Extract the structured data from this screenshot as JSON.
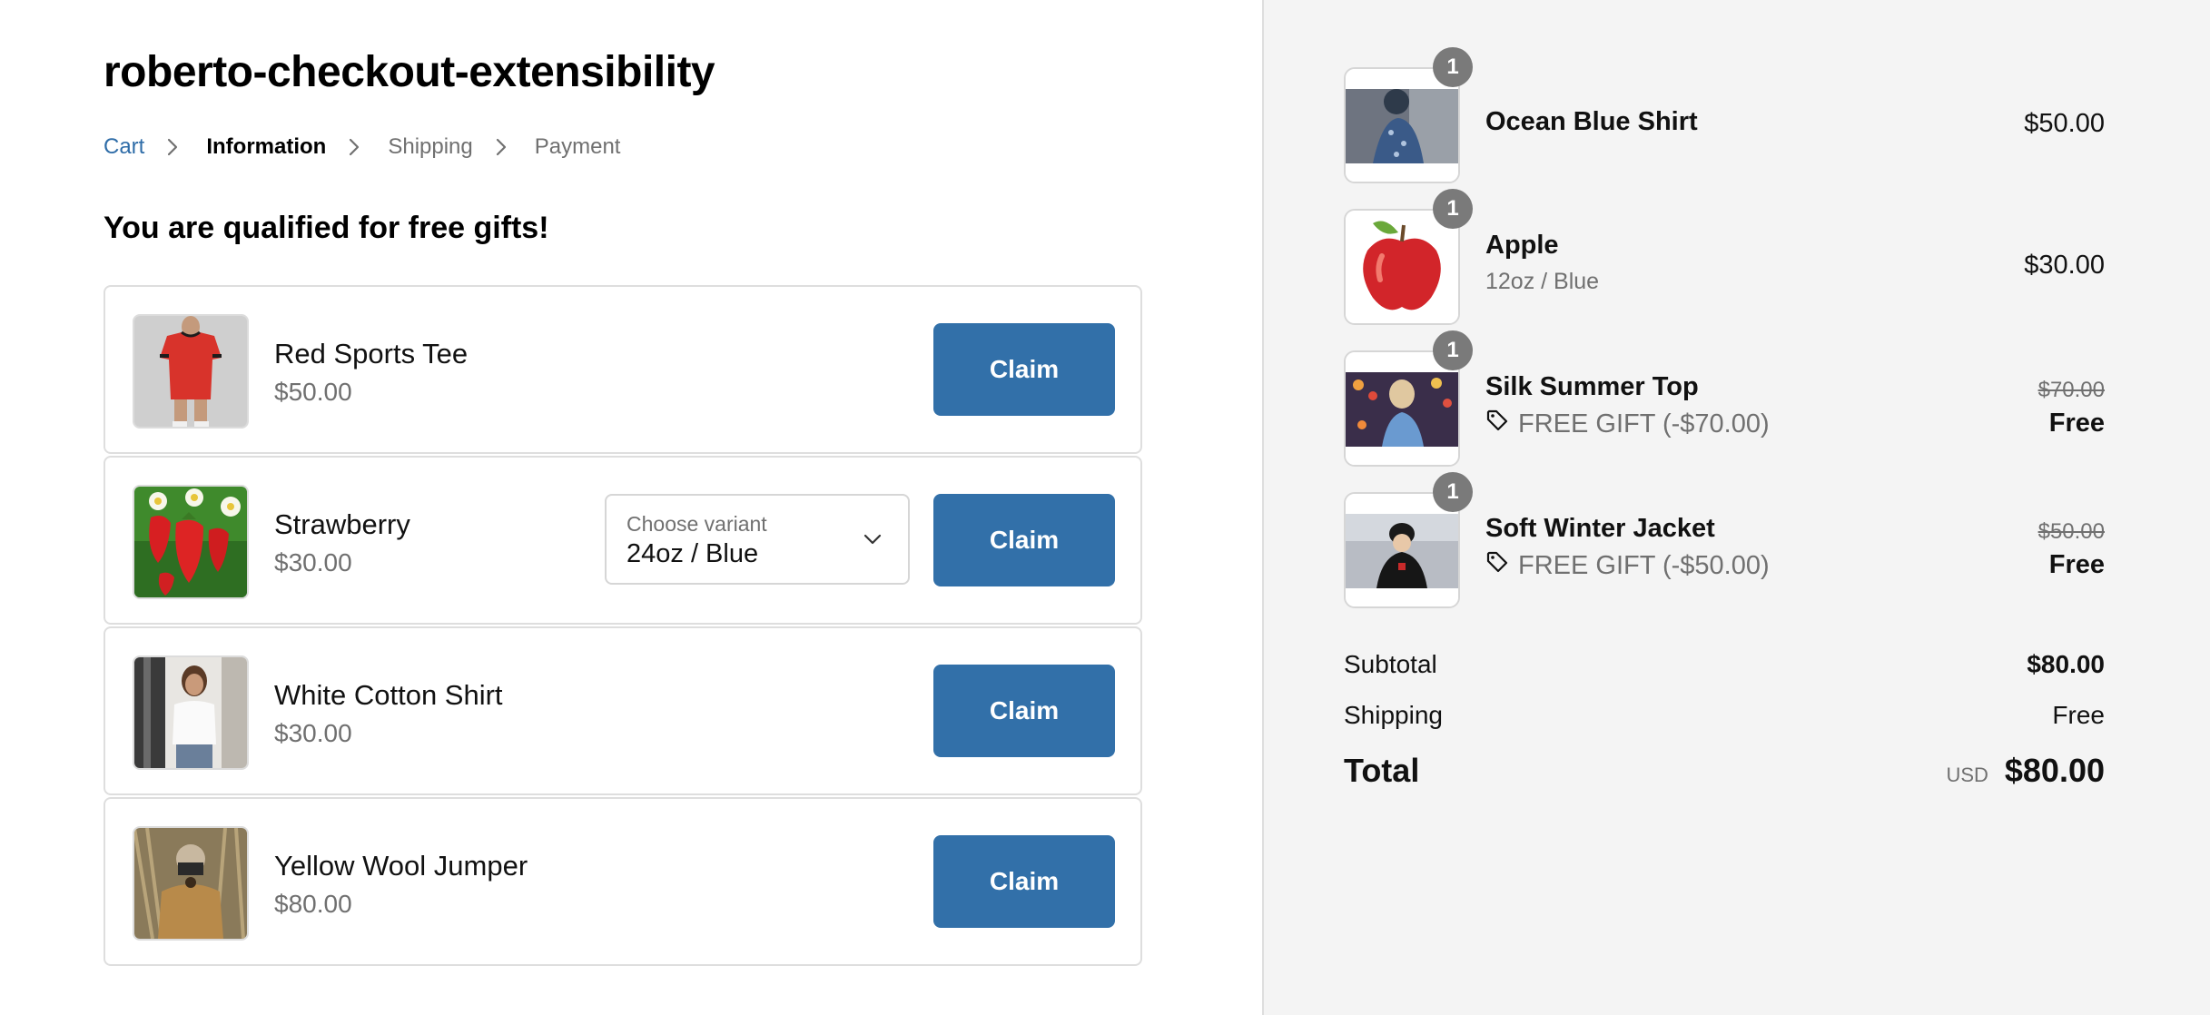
{
  "shop": {
    "title": "roberto-checkout-extensibility"
  },
  "breadcrumb": {
    "cart": "Cart",
    "information": "Information",
    "shipping": "Shipping",
    "payment": "Payment"
  },
  "gifts": {
    "heading": "You are qualified for free gifts!",
    "claim_label": "Claim",
    "variant_label": "Choose variant",
    "items": [
      {
        "name": "Red Sports Tee",
        "price": "$50.00",
        "image": "red-sports-tee"
      },
      {
        "name": "Strawberry",
        "price": "$30.00",
        "image": "strawberry",
        "selected_variant": "24oz / Blue"
      },
      {
        "name": "White Cotton Shirt",
        "price": "$30.00",
        "image": "white-cotton-shirt"
      },
      {
        "name": "Yellow Wool Jumper",
        "price": "$80.00",
        "image": "yellow-wool-jumper"
      }
    ]
  },
  "order": {
    "items": [
      {
        "qty": "1",
        "name": "Ocean Blue Shirt",
        "price": "$50.00"
      },
      {
        "qty": "1",
        "name": "Apple",
        "variant": "12oz / Blue",
        "price": "$30.00"
      },
      {
        "qty": "1",
        "name": "Silk Summer Top",
        "gift": "FREE GIFT (-$70.00)",
        "compare_price": "$70.00",
        "price": "Free"
      },
      {
        "qty": "1",
        "name": "Soft Winter Jacket",
        "gift": "FREE GIFT (-$50.00)",
        "compare_price": "$50.00",
        "price": "Free"
      }
    ],
    "subtotal_label": "Subtotal",
    "subtotal": "$80.00",
    "shipping_label": "Shipping",
    "shipping": "Free",
    "total_label": "Total",
    "currency": "USD",
    "total": "$80.00"
  },
  "colors": {
    "accent": "#3270a9",
    "link": "#2f6da8",
    "sidebar_bg": "#f4f4f4"
  }
}
